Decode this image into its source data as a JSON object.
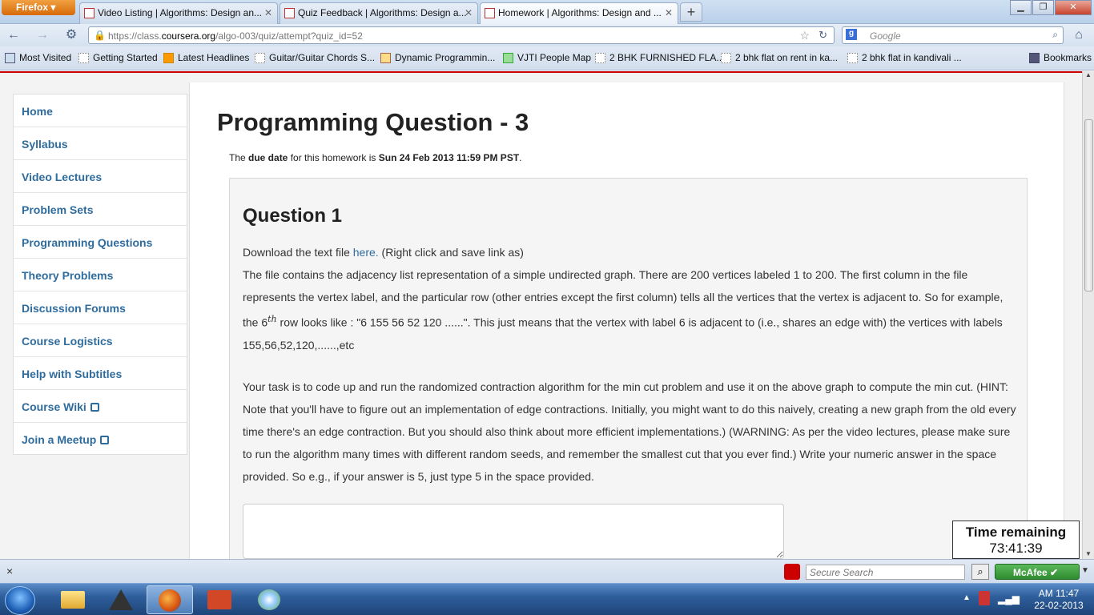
{
  "browser": {
    "menu_label": "Firefox",
    "tabs": [
      {
        "label": "Video Listing | Algorithms: Design an...",
        "active": false
      },
      {
        "label": "Quiz Feedback | Algorithms: Design a...",
        "active": false
      },
      {
        "label": "Homework | Algorithms: Design and ...",
        "active": true
      }
    ],
    "new_tab_label": "+",
    "url_prefix": "https://class.",
    "url_host": "coursera.org",
    "url_path": "/algo-003/quiz/attempt?quiz_id=52",
    "search_placeholder": "Google",
    "bookmarks": [
      {
        "label": "Most Visited"
      },
      {
        "label": "Getting Started"
      },
      {
        "label": "Latest Headlines"
      },
      {
        "label": "Guitar/Guitar Chords S..."
      },
      {
        "label": "Dynamic Programmin..."
      },
      {
        "label": "VJTI People Map"
      },
      {
        "label": "2 BHK FURNISHED FLA..."
      },
      {
        "label": "2 bhk flat on rent in ka..."
      },
      {
        "label": "2 bhk flat in kandivali ..."
      }
    ],
    "bookmarks_menu_label": "Bookmarks"
  },
  "sidebar": {
    "items": [
      {
        "label": "Home"
      },
      {
        "label": "Syllabus"
      },
      {
        "label": "Video Lectures"
      },
      {
        "label": "Problem Sets"
      },
      {
        "label": "Programming Questions"
      },
      {
        "label": "Theory Problems"
      },
      {
        "label": "Discussion Forums"
      },
      {
        "label": "Course Logistics"
      },
      {
        "label": "Help with Subtitles"
      },
      {
        "label": "Course Wiki"
      },
      {
        "label": "Join a Meetup"
      }
    ]
  },
  "main": {
    "title": "Programming Question - 3",
    "due_prefix": "The ",
    "due_bold": "due date",
    "due_mid": " for this homework is ",
    "due_date": "Sun 24 Feb 2013 11:59 PM PST",
    "due_suffix": ".",
    "question_title": "Question 1",
    "download_prefix": "Download the text file ",
    "download_link": "here.",
    "download_suffix": " (Right click and save link as)",
    "para1_a": "The file contains the adjacency list representation of a simple undirected graph. There are 200 vertices labeled 1 to 200. The first column in the file represents the vertex label, and the particular row (other entries except the first column) tells all the vertices that the vertex is adjacent to. So for example, the 6",
    "para1_sup": "th",
    "para1_b": " row looks like : \"6 155 56 52 120 ......\". This just means that the vertex with label 6 is adjacent to (i.e., shares an edge with) the vertices with labels 155,56,52,120,......,etc",
    "para2": "Your task is to code up and run the randomized contraction algorithm for the min cut problem and use it on the above graph to compute the min cut. (HINT: Note that you'll have to figure out an implementation of edge contractions. Initially, you might want to do this naively, creating a new graph from the old every time there's an edge contraction. But you should also think about more efficient implementations.) (WARNING: As per the video lectures, please make sure to run the algorithm many times with different random seeds, and remember the smallest cut that you ever find.) Write your numeric answer in the space provided. So e.g., if your answer is 5, just type 5 in the space provided.",
    "answer_value": ""
  },
  "timer": {
    "label": "Time remaining",
    "value": "73:41:39"
  },
  "addon_bar": {
    "close_label": "×",
    "secure_search_placeholder": "Secure Search",
    "mcafee_label": "McAfee"
  },
  "taskbar": {
    "time": "AM 11:47",
    "date": "22-02-2013"
  },
  "colors": {
    "link": "#2f6c9e",
    "accent_red": "#cc0000",
    "firefox_orange": "#e07a1a"
  }
}
